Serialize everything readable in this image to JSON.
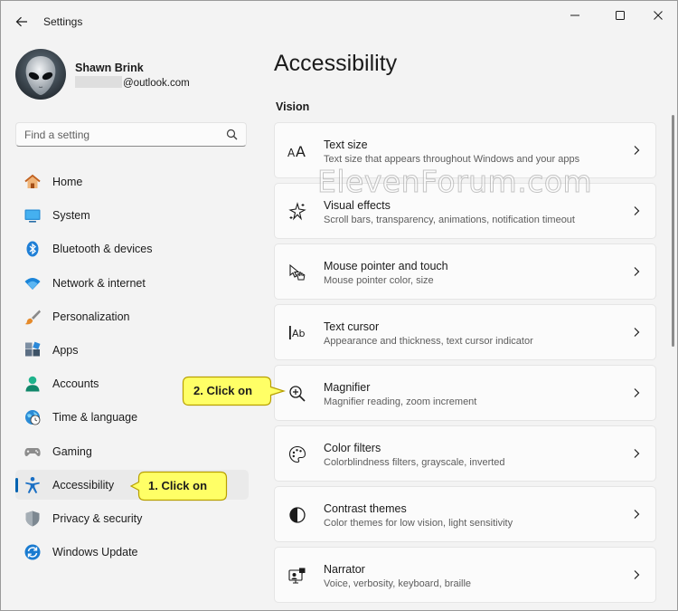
{
  "window": {
    "title": "Settings"
  },
  "profile": {
    "name": "Shawn Brink",
    "email_suffix": "@outlook.com"
  },
  "search": {
    "placeholder": "Find a setting"
  },
  "nav": {
    "items": [
      {
        "label": "Home",
        "icon": "home-icon"
      },
      {
        "label": "System",
        "icon": "system-icon"
      },
      {
        "label": "Bluetooth & devices",
        "icon": "bluetooth-icon"
      },
      {
        "label": "Network & internet",
        "icon": "wifi-icon"
      },
      {
        "label": "Personalization",
        "icon": "brush-icon"
      },
      {
        "label": "Apps",
        "icon": "apps-icon"
      },
      {
        "label": "Accounts",
        "icon": "accounts-icon"
      },
      {
        "label": "Time & language",
        "icon": "time-language-icon"
      },
      {
        "label": "Gaming",
        "icon": "gamepad-icon"
      },
      {
        "label": "Accessibility",
        "icon": "accessibility-icon",
        "selected": true
      },
      {
        "label": "Privacy & security",
        "icon": "shield-icon"
      },
      {
        "label": "Windows Update",
        "icon": "update-icon"
      }
    ]
  },
  "main": {
    "title": "Accessibility",
    "section": "Vision",
    "cards": [
      {
        "title": "Text size",
        "desc": "Text size that appears throughout Windows and your apps",
        "icon": "text-size-icon"
      },
      {
        "title": "Visual effects",
        "desc": "Scroll bars, transparency, animations, notification timeout",
        "icon": "visual-effects-icon"
      },
      {
        "title": "Mouse pointer and touch",
        "desc": "Mouse pointer color, size",
        "icon": "mouse-pointer-icon"
      },
      {
        "title": "Text cursor",
        "desc": "Appearance and thickness, text cursor indicator",
        "icon": "text-cursor-icon"
      },
      {
        "title": "Magnifier",
        "desc": "Magnifier reading, zoom increment",
        "icon": "magnifier-icon"
      },
      {
        "title": "Color filters",
        "desc": "Colorblindness filters, grayscale, inverted",
        "icon": "palette-icon"
      },
      {
        "title": "Contrast themes",
        "desc": "Color themes for low vision, light sensitivity",
        "icon": "contrast-icon"
      },
      {
        "title": "Narrator",
        "desc": "Voice, verbosity, keyboard, braille",
        "icon": "narrator-icon"
      }
    ]
  },
  "watermark": "ElevenForum.com",
  "callouts": {
    "step1": "1. Click on",
    "step2": "2. Click on"
  },
  "colors": {
    "accent": "#0063b1",
    "callout_fill": "#ffff66",
    "callout_border": "#b8a000"
  }
}
